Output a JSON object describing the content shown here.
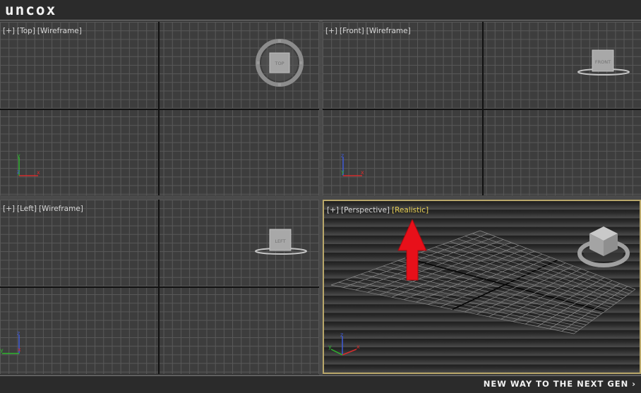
{
  "app": {
    "logo_text": "uncox",
    "tagline": "NEW WAY TO THE NEXT GEN ›"
  },
  "viewports": {
    "top": {
      "plus": "[+]",
      "view": "[Top]",
      "shading": "[Wireframe]",
      "cube_label": "TOP"
    },
    "front": {
      "plus": "[+]",
      "view": "[Front]",
      "shading": "[Wireframe]",
      "cube_label": "FRONT"
    },
    "left": {
      "plus": "[+]",
      "view": "[Left]",
      "shading": "[Wireframe]",
      "cube_label": "LEFT"
    },
    "perspective": {
      "plus": "[+]",
      "view": "[Perspective]",
      "shading": "[Realistic]"
    }
  },
  "axes": {
    "x": "x",
    "y": "y",
    "z": "z"
  },
  "colors": {
    "active_border": "#b9a76a",
    "highlight_text": "#e7cf55",
    "arrow": "#e8101a",
    "axis_x": "#d42d2d",
    "axis_y": "#2fb52f",
    "axis_z": "#3f5bd8"
  },
  "icons": {
    "navcube": "viewcube-icon",
    "arrow": "up-arrow-icon",
    "tripod": "axis-tripod-icon"
  }
}
